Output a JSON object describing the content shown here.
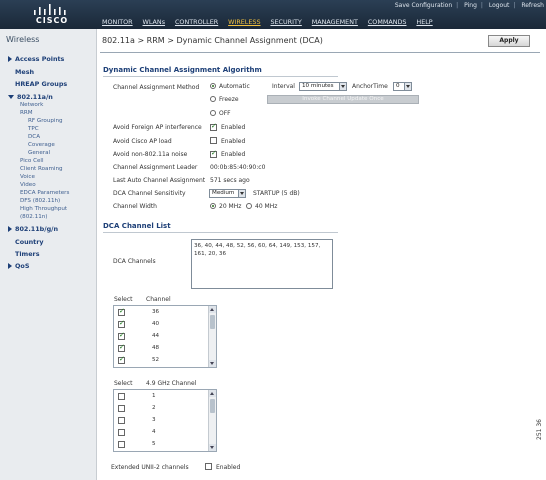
{
  "header": {
    "logo_text": "CISCO",
    "top_links": [
      "Save Configuration",
      "Ping",
      "Logout",
      "Refresh"
    ],
    "nav": [
      "MONITOR",
      "WLANs",
      "CONTROLLER",
      "WIRELESS",
      "SECURITY",
      "MANAGEMENT",
      "COMMANDS",
      "HELP"
    ],
    "active_nav": "WIRELESS"
  },
  "sidebar": {
    "title": "Wireless",
    "items": [
      {
        "label": "Access Points"
      },
      {
        "label": "Mesh"
      },
      {
        "label": "HREAP Groups"
      },
      {
        "label": "802.11a/n"
      },
      {
        "label": "802.11b/g/n"
      },
      {
        "label": "Country"
      },
      {
        "label": "Timers"
      },
      {
        "label": "QoS"
      }
    ],
    "sub_802_11a": [
      "Network",
      "RRM"
    ],
    "sub_rrm": [
      "RF Grouping",
      "TPC",
      "DCA",
      "Coverage",
      "General"
    ],
    "sub_802_11a_more": [
      "Pico Cell",
      "Client Roaming",
      "Voice",
      "Video",
      "EDCA Parameters",
      "DFS (802.11h)",
      "High Throughput",
      "(802.11n)"
    ]
  },
  "page": {
    "title": "802.11a > RRM > Dynamic Channel Assignment (DCA)",
    "apply_label": "Apply"
  },
  "algorithm": {
    "section_title": "Dynamic Channel Assignment Algorithm",
    "method_label": "Channel Assignment Method",
    "method_options": [
      "Automatic",
      "Freeze",
      "OFF"
    ],
    "method_selected": "Automatic",
    "interval_label": "Interval",
    "interval_value": "10 minutes",
    "anchor_label": "AnchorTime",
    "anchor_value": "0",
    "invoke_label": "Invoke Channel Update Once",
    "avoid_foreign_label": "Avoid Foreign AP interference",
    "avoid_cisco_label": "Avoid Cisco AP load",
    "avoid_non80211_label": "Avoid non-802.11a noise",
    "enabled_label": "Enabled",
    "avoid_foreign_checked": true,
    "avoid_cisco_checked": false,
    "avoid_non80211_checked": true,
    "leader_label": "Channel Assignment Leader",
    "leader_value": "00:0b:85:40:90:c0",
    "last_run_label": "Last Auto Channel Assignment",
    "last_run_value": "571 secs ago",
    "sensitivity_label": "DCA Channel Sensitivity",
    "sensitivity_value": "Medium",
    "sensitivity_note": "STARTUP (5 dB)",
    "width_label": "Channel Width",
    "width_options": [
      "20 MHz",
      "40 MHz"
    ],
    "width_selected": "20 MHz"
  },
  "channel_list": {
    "section_title": "DCA Channel List",
    "dca_channels_label": "DCA Channels",
    "dca_channels_value": "36, 40, 44, 48, 52, 56, 60, 64, 149, 153, 157, 161, 20, 36",
    "select_header": "Select",
    "channel_header": "Channel",
    "channels": [
      {
        "value": "36",
        "checked": true
      },
      {
        "value": "40",
        "checked": true
      },
      {
        "value": "44",
        "checked": true
      },
      {
        "value": "48",
        "checked": true
      },
      {
        "value": "52",
        "checked": true
      }
    ],
    "ghz_select_header": "Select",
    "ghz_channel_header": "4.9 GHz Channel",
    "ghz_channels": [
      {
        "value": "1",
        "checked": false
      },
      {
        "value": "2",
        "checked": false
      },
      {
        "value": "3",
        "checked": false
      },
      {
        "value": "4",
        "checked": false
      },
      {
        "value": "5",
        "checked": false
      }
    ],
    "unii2_label": "Extended UNII-2 channels",
    "unii2_enabled_label": "Enabled",
    "unii2_checked": false
  },
  "figure_id": "251 36"
}
